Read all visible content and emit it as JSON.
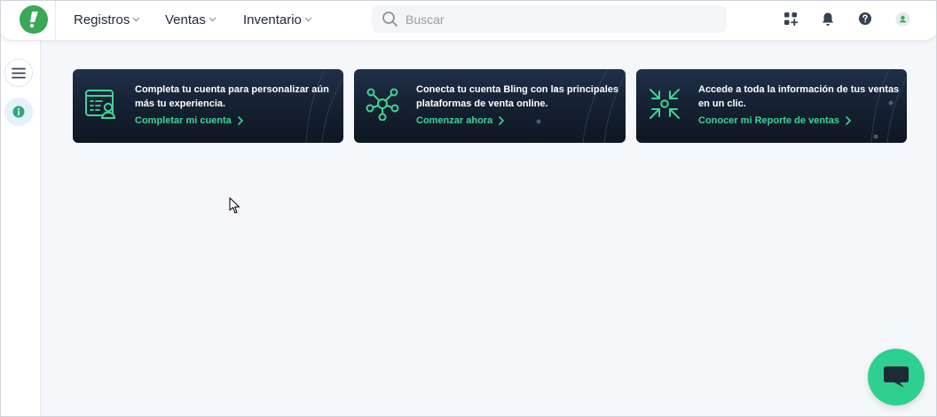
{
  "header": {
    "logo_icon": "bling-logo-icon",
    "nav": [
      {
        "label": "Registros"
      },
      {
        "label": "Ventas"
      },
      {
        "label": "Inventario"
      }
    ],
    "search": {
      "placeholder": "Buscar",
      "value": ""
    },
    "icons": [
      "apps-plus-icon",
      "bell-icon",
      "help-icon",
      "avatar-icon"
    ]
  },
  "sidebar": {
    "icons": [
      "menu-icon",
      "info-icon"
    ]
  },
  "cards": [
    {
      "text": "Completa tu cuenta para personalizar aún más tu experiencia.",
      "link": "Completar mi cuenta",
      "icon": "profile-card-icon"
    },
    {
      "text": "Conecta tu cuenta Bling con las principales plataformas de venta online.",
      "link": "Comenzar ahora",
      "icon": "network-hub-icon"
    },
    {
      "text": "Accede a toda la información de tus ventas en un clic.",
      "link": "Conocer mi Reporte de ventas",
      "icon": "collapse-arrows-icon"
    }
  ],
  "chat": {
    "icon": "chat-bubble-icon"
  },
  "colors": {
    "brand": "#3aa856",
    "accent": "#3fd493",
    "card_bg": "#141e2e",
    "chat": "#2ed08f"
  }
}
